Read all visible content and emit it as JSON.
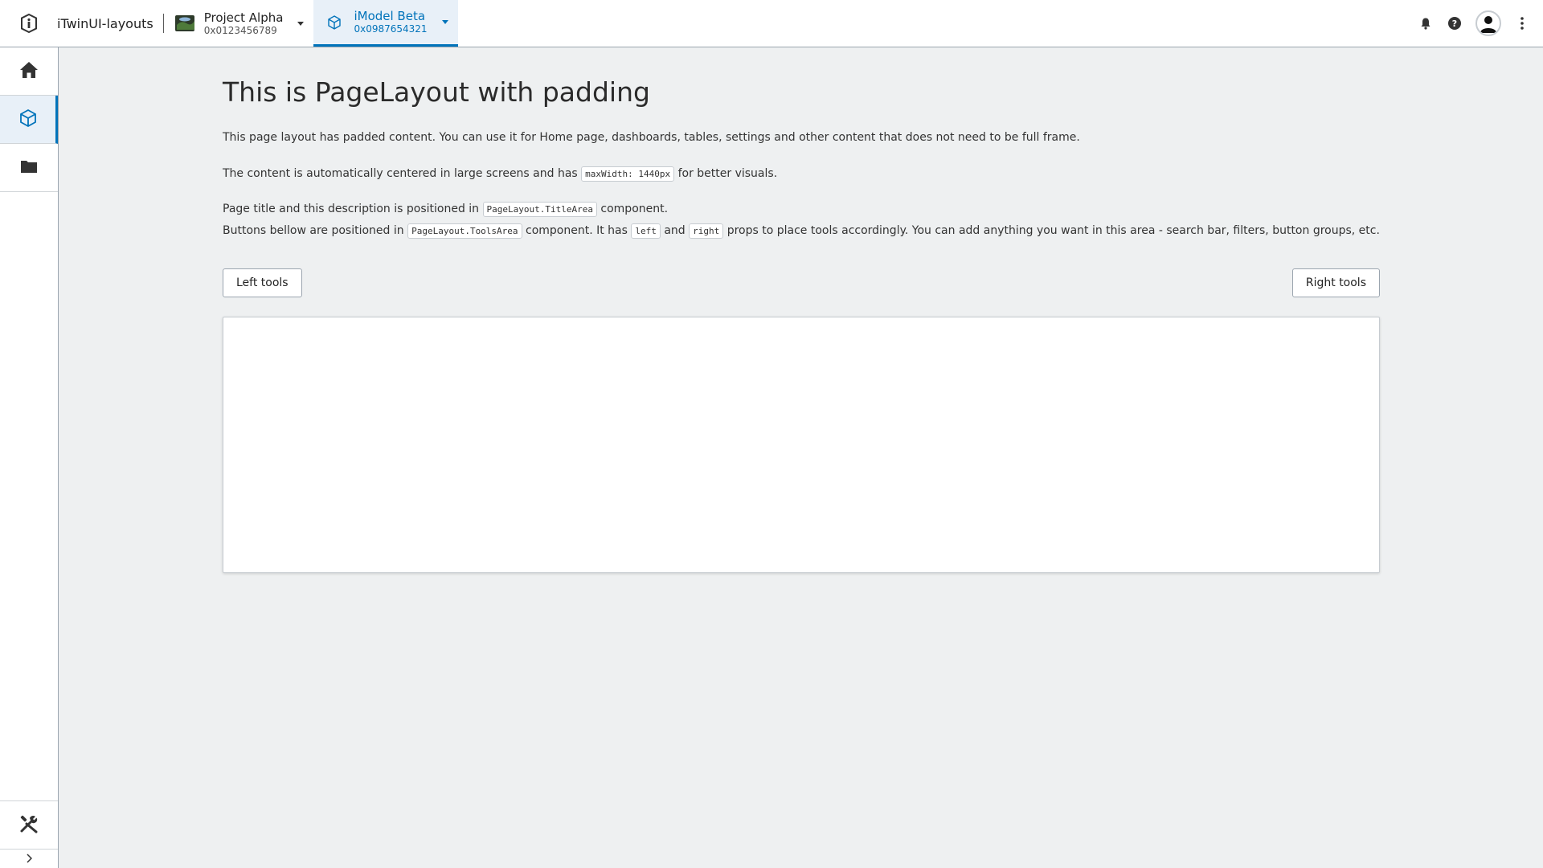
{
  "header": {
    "app_title": "iTwinUI-layouts",
    "project": {
      "name": "Project Alpha",
      "id": "0x0123456789"
    },
    "imodel": {
      "name": "iModel Beta",
      "id": "0x0987654321"
    },
    "icons": [
      "logo-icon",
      "bell-icon",
      "help-icon",
      "avatar",
      "more-icon"
    ]
  },
  "sidebar": {
    "items": [
      {
        "icon": "home-icon"
      },
      {
        "icon": "imodel-icon",
        "active": true
      },
      {
        "icon": "folder-icon"
      }
    ],
    "bottom": [
      {
        "icon": "tools-icon"
      }
    ],
    "expand_icon": "chevron-right-icon"
  },
  "main": {
    "title": "This is PageLayout with padding",
    "p1": "This page layout has padded content. You can use it for Home page, dashboards, tables, settings and other content that does not need to be full frame.",
    "p2_before": "The content is automatically centered in large screens and has",
    "p2_code": "maxWidth: 1440px",
    "p2_after": "for better visuals.",
    "p3_before": "Page title and this description is positioned in",
    "p3_code": "PageLayout.TitleArea",
    "p3_after": "component.",
    "p4_before": "Buttons bellow are positioned in",
    "p4_code1": "PageLayout.ToolsArea",
    "p4_mid1": "component. It has",
    "p4_code2": "left",
    "p4_mid2": "and",
    "p4_code3": "right",
    "p4_after": "props to place tools accordingly. You can add anything you want in this area - search bar, filters, button groups, etc.",
    "left_tools": "Left tools",
    "right_tools": "Right tools"
  },
  "colors": {
    "accent": "#0073ba",
    "background": "#eef0f1"
  }
}
